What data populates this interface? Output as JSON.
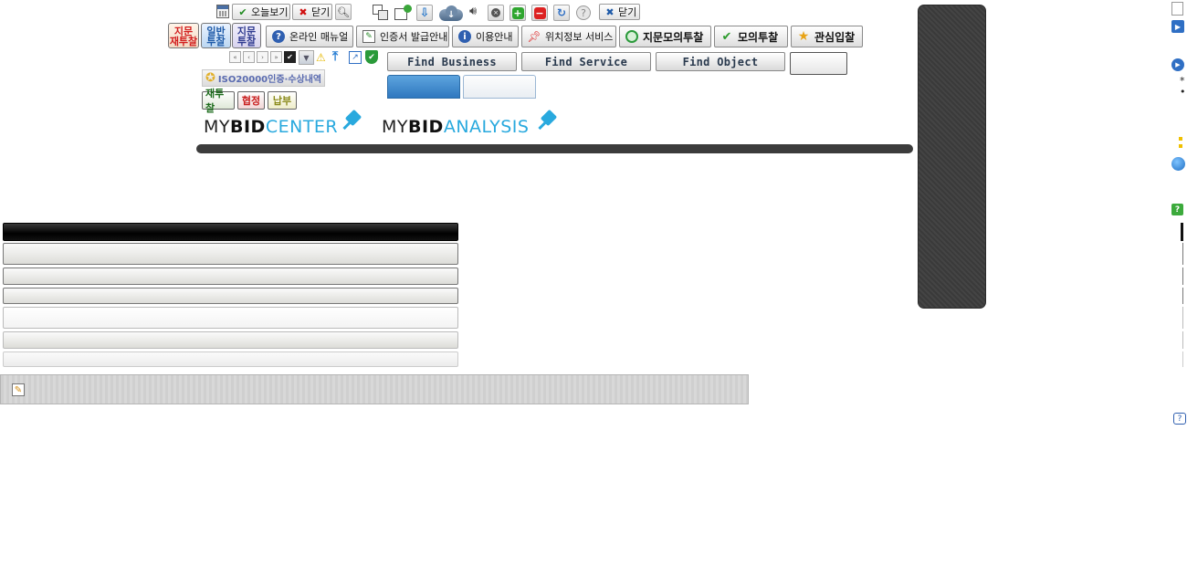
{
  "toolbar": {
    "today_label": "오늘보기",
    "close_label": "닫기",
    "close2_label": "닫기"
  },
  "modes": {
    "fingerprint_rebid": [
      "지문",
      "재투찰"
    ],
    "general_bid": [
      "일반",
      "투찰"
    ],
    "fingerprint_bid": [
      "지문",
      "투찰"
    ]
  },
  "nav": {
    "online_manual": "온라인 매뉴얼",
    "certificate_guide": "인증서 발급안내",
    "usage_guide": "이용안내",
    "location_service": "위치정보 서비스",
    "fingerprint_mock_bid": "지문모의투찰",
    "mock_bid": "모의투찰",
    "interest_bid": "관심입찰"
  },
  "find": {
    "business": "Find Business",
    "service": "Find Service",
    "object": "Find Object"
  },
  "iso_label": "ISO20000인증·수상내역",
  "small_buttons": {
    "rebid": "재투찰",
    "agreement": "협정",
    "payment": "납부"
  },
  "logos": {
    "center": {
      "pre": "MY",
      "bold": "BID",
      "post": "CENTER"
    },
    "analysis": {
      "pre": "MY",
      "bold": "BID",
      "post": "ANALYSIS"
    }
  },
  "right_side": {
    "asterisk": "*",
    "bullet": "•"
  },
  "colors": {
    "accent_blue": "#29a9de",
    "dark_panel": "#3c3c3c",
    "rebid_red": "#d21d1d",
    "general_blue": "#1e5aa8"
  }
}
